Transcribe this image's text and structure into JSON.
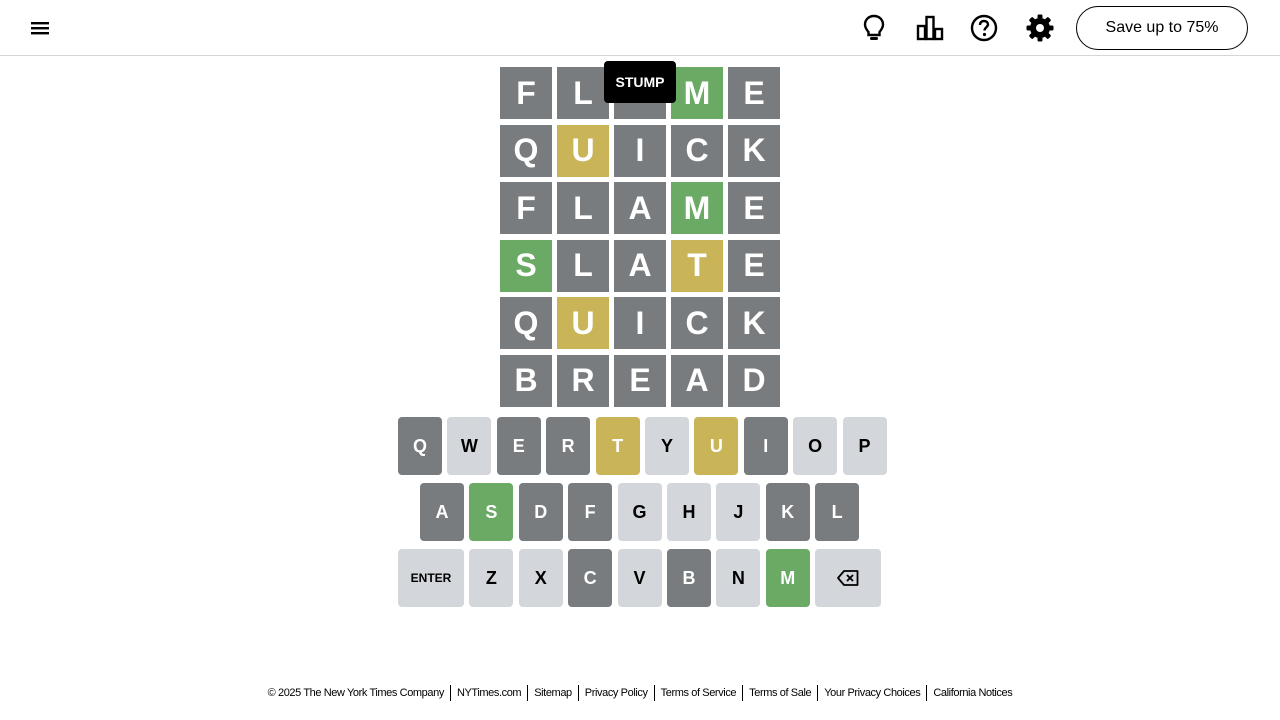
{
  "header": {
    "menu_icon": "hamburger-menu-icon",
    "icons": [
      "lightbulb-icon",
      "bar-chart-icon",
      "help-circle-icon",
      "gear-icon"
    ],
    "save_label": "Save up to 75%"
  },
  "tooltip": {
    "text": "STUMP"
  },
  "board": {
    "rows": [
      [
        {
          "l": "F",
          "s": "absent"
        },
        {
          "l": "L",
          "s": "absent"
        },
        {
          "l": "",
          "s": "absent"
        },
        {
          "l": "M",
          "s": "correct"
        },
        {
          "l": "E",
          "s": "absent"
        }
      ],
      [
        {
          "l": "Q",
          "s": "absent"
        },
        {
          "l": "U",
          "s": "present"
        },
        {
          "l": "I",
          "s": "absent"
        },
        {
          "l": "C",
          "s": "absent"
        },
        {
          "l": "K",
          "s": "absent"
        }
      ],
      [
        {
          "l": "F",
          "s": "absent"
        },
        {
          "l": "L",
          "s": "absent"
        },
        {
          "l": "A",
          "s": "absent"
        },
        {
          "l": "M",
          "s": "correct"
        },
        {
          "l": "E",
          "s": "absent"
        }
      ],
      [
        {
          "l": "S",
          "s": "correct"
        },
        {
          "l": "L",
          "s": "absent"
        },
        {
          "l": "A",
          "s": "absent"
        },
        {
          "l": "T",
          "s": "present"
        },
        {
          "l": "E",
          "s": "absent"
        }
      ],
      [
        {
          "l": "Q",
          "s": "absent"
        },
        {
          "l": "U",
          "s": "present"
        },
        {
          "l": "I",
          "s": "absent"
        },
        {
          "l": "C",
          "s": "absent"
        },
        {
          "l": "K",
          "s": "absent"
        }
      ],
      [
        {
          "l": "B",
          "s": "absent"
        },
        {
          "l": "R",
          "s": "absent"
        },
        {
          "l": "E",
          "s": "absent"
        },
        {
          "l": "A",
          "s": "absent"
        },
        {
          "l": "D",
          "s": "absent"
        }
      ]
    ]
  },
  "keyboard": {
    "rows": [
      [
        {
          "k": "Q",
          "s": "absent"
        },
        {
          "k": "W",
          "s": "unused"
        },
        {
          "k": "E",
          "s": "absent"
        },
        {
          "k": "R",
          "s": "absent"
        },
        {
          "k": "T",
          "s": "present"
        },
        {
          "k": "Y",
          "s": "unused"
        },
        {
          "k": "U",
          "s": "present"
        },
        {
          "k": "I",
          "s": "absent"
        },
        {
          "k": "O",
          "s": "unused"
        },
        {
          "k": "P",
          "s": "unused"
        }
      ],
      [
        {
          "k": "A",
          "s": "absent"
        },
        {
          "k": "S",
          "s": "correct"
        },
        {
          "k": "D",
          "s": "absent"
        },
        {
          "k": "F",
          "s": "absent"
        },
        {
          "k": "G",
          "s": "unused"
        },
        {
          "k": "H",
          "s": "unused"
        },
        {
          "k": "J",
          "s": "unused"
        },
        {
          "k": "K",
          "s": "absent"
        },
        {
          "k": "L",
          "s": "absent"
        }
      ],
      [
        {
          "k": "ENTER",
          "s": "unused"
        },
        {
          "k": "Z",
          "s": "unused"
        },
        {
          "k": "X",
          "s": "unused"
        },
        {
          "k": "C",
          "s": "absent"
        },
        {
          "k": "V",
          "s": "unused"
        },
        {
          "k": "B",
          "s": "absent"
        },
        {
          "k": "N",
          "s": "unused"
        },
        {
          "k": "M",
          "s": "correct"
        },
        {
          "k": "backspace-icon",
          "s": "unused"
        }
      ]
    ]
  },
  "colors": {
    "absent": "#787c7e",
    "present": "#c9b458",
    "correct": "#6aaa64",
    "unused": "#d3d6da"
  },
  "footer": {
    "copyright": "© 2025 The New York Times Company",
    "links": [
      "NYTimes.com",
      "Sitemap",
      "Privacy Policy",
      "Terms of Service",
      "Terms of Sale",
      "Your Privacy Choices",
      "California Notices"
    ]
  }
}
